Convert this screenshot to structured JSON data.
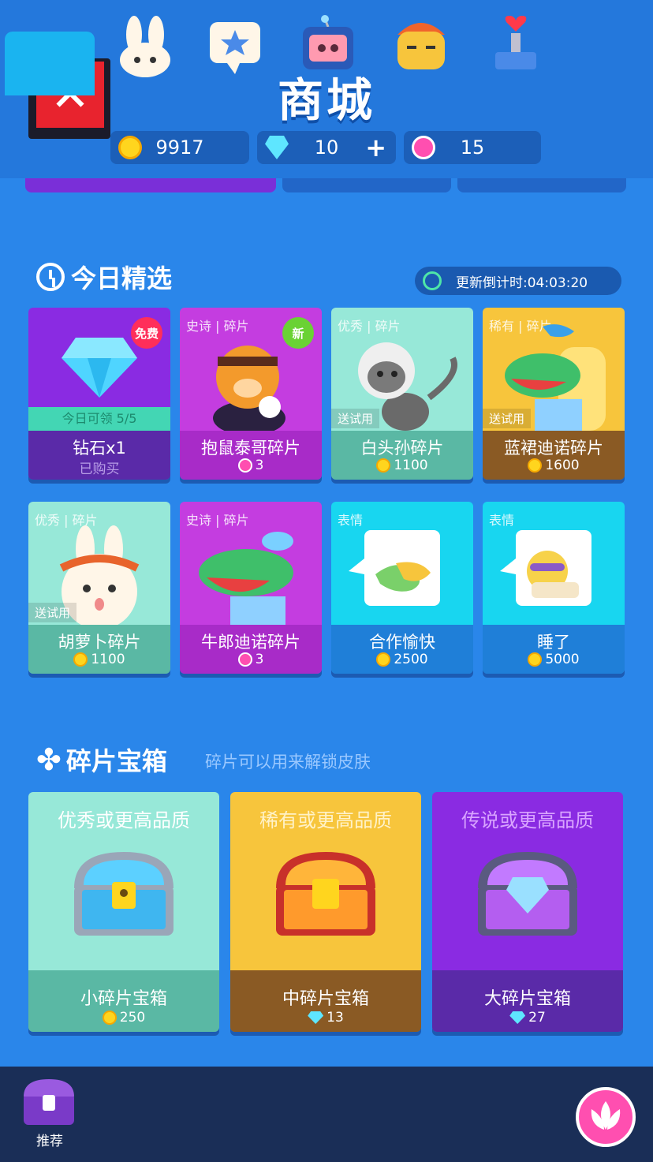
{
  "header": {
    "title": "商城",
    "close_icon": "close-icon",
    "coins": "9917",
    "diamonds": "10",
    "lotus": "15",
    "plus": "+"
  },
  "featured": {
    "title": "今日精选",
    "timer": "更新倒计时:04:03:20",
    "items": [
      {
        "tag": "",
        "name": "钻石x1",
        "price": "已购买",
        "currency": "none",
        "badge": "免费",
        "claim": "今日可领 5/5"
      },
      {
        "tag": "史诗 | 碎片",
        "name": "抱鼠泰哥碎片",
        "price": "3",
        "currency": "lotus",
        "badge": "新"
      },
      {
        "tag": "优秀 | 碎片",
        "name": "白头孙碎片",
        "price": "1100",
        "currency": "coin",
        "trial": "送试用"
      },
      {
        "tag": "稀有 | 碎片",
        "name": "蓝裙迪诺碎片",
        "price": "1600",
        "currency": "coin",
        "trial": "送试用"
      },
      {
        "tag": "优秀 | 碎片",
        "name": "胡萝卜碎片",
        "price": "1100",
        "currency": "coin",
        "trial": "送试用"
      },
      {
        "tag": "史诗 | 碎片",
        "name": "牛郎迪诺碎片",
        "price": "3",
        "currency": "lotus"
      },
      {
        "tag": "表情",
        "name": "合作愉快",
        "price": "2500",
        "currency": "coin"
      },
      {
        "tag": "表情",
        "name": "睡了",
        "price": "5000",
        "currency": "coin"
      }
    ]
  },
  "chests": {
    "title": "碎片宝箱",
    "note": "碎片可以用来解锁皮肤",
    "items": [
      {
        "quality": "优秀或更高品质",
        "name": "小碎片宝箱",
        "price": "250",
        "currency": "coin"
      },
      {
        "quality": "稀有或更高品质",
        "name": "中碎片宝箱",
        "price": "13",
        "currency": "gem"
      },
      {
        "quality": "传说或更高品质",
        "name": "大碎片宝箱",
        "price": "27",
        "currency": "gem"
      }
    ]
  },
  "nav": {
    "active_label": "推荐",
    "icons": [
      "chest-icon",
      "bunny-icon",
      "star-bubble-icon",
      "tv-icon",
      "face-icon",
      "stamp-icon",
      "lotus-icon"
    ]
  },
  "colors": {
    "background": "#2a86ea",
    "header": "#2478dc",
    "purple": "#8a2be2",
    "magenta": "#c43de0",
    "mint": "#97e8d8",
    "yellow": "#f7c53c",
    "cyan": "#18d6f0"
  }
}
